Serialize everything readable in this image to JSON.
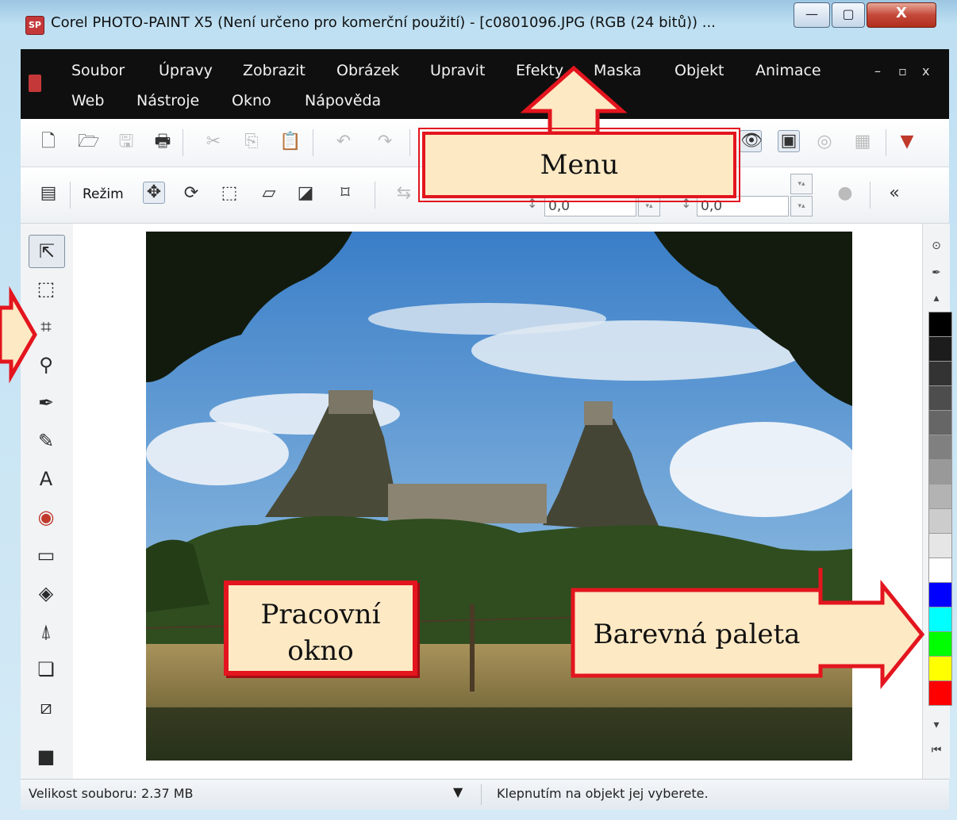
{
  "window": {
    "title": "Corel PHOTO-PAINT X5 (Není určeno pro komerční použití) - [c0801096.JPG (RGB (24 bitů)) ...",
    "app_icon_text": "SP",
    "controls": {
      "minimize": "—",
      "maximize": "▢",
      "close": "X"
    }
  },
  "menu": {
    "row1": [
      "Soubor",
      "Úpravy",
      "Zobrazit",
      "Obrázek",
      "Upravit",
      "Efekty",
      "Maska",
      "Objekt",
      "Animace"
    ],
    "row2": [
      "Web",
      "Nástroje",
      "Okno",
      "Nápověda"
    ],
    "doc_controls": {
      "minimize": "–",
      "restore": "▫",
      "close": "x"
    }
  },
  "toolbar": {
    "icons": [
      "new-icon",
      "open-icon",
      "save-icon",
      "print-icon",
      "cut-icon",
      "copy-icon",
      "paste-icon",
      "undo-icon",
      "redo-icon",
      "view-icon",
      "preview-icon",
      "object-icon",
      "mask-icon",
      "options-icon"
    ]
  },
  "property_bar": {
    "mode_label": "Režim",
    "field1_value": "0,0",
    "field2_value": "0,0"
  },
  "toolbox": {
    "tools": [
      "pick-tool-icon",
      "mask-rect-icon",
      "crop-icon",
      "zoom-icon",
      "eyedropper-icon",
      "eraser-icon",
      "text-icon",
      "red-eye-icon",
      "rectangle-icon",
      "fill-icon",
      "effect-icon",
      "shadow-icon",
      "transparency-icon",
      "color-swap-icon"
    ]
  },
  "palette": {
    "colors": [
      "#000000",
      "#1c1c1c",
      "#333333",
      "#4d4d4d",
      "#666666",
      "#808080",
      "#999999",
      "#b3b3b3",
      "#cccccc",
      "#e6e6e6",
      "#ffffff",
      "#0000ff",
      "#00ffff",
      "#00ff00",
      "#ffff00",
      "#ff0000"
    ]
  },
  "status": {
    "file_size": "Velikost souboru: 2.37 MB",
    "hint": "Klepnutím na objekt jej vyberete."
  },
  "callouts": {
    "menu": "Menu",
    "work_area_line1": "Pracovní",
    "work_area_line2": "okno",
    "palette": "Barevná paleta"
  },
  "accent_color": "#e3151e",
  "callout_fill": "#fde9c4"
}
